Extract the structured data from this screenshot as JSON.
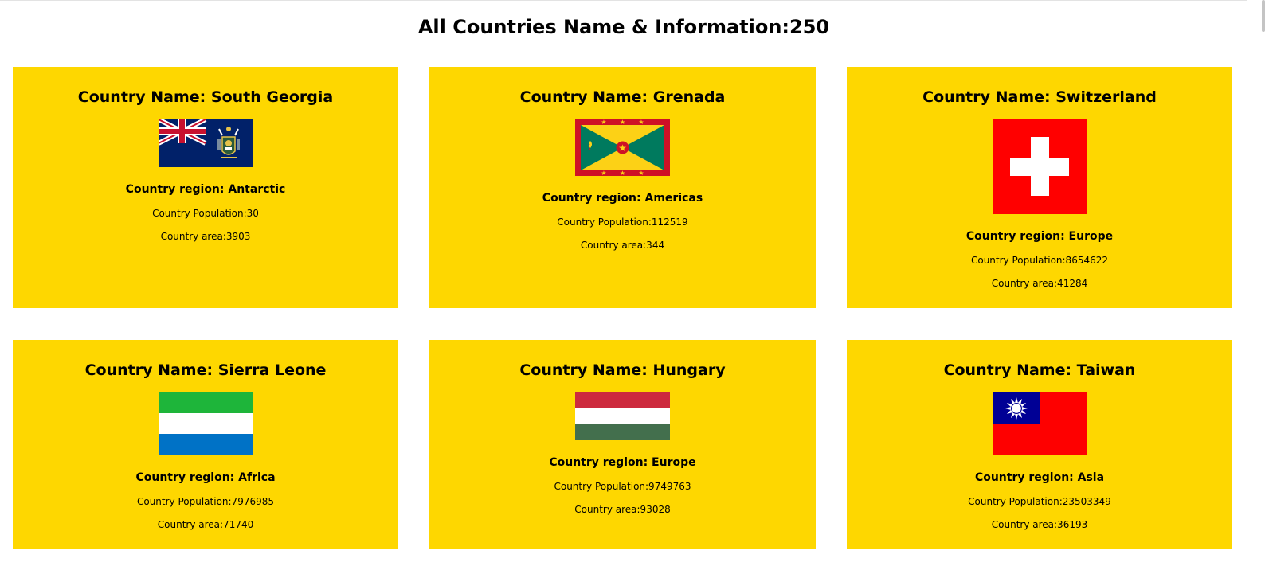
{
  "page": {
    "title": "All Countries Name & Information:250"
  },
  "labels": {
    "name_prefix": "Country Name: ",
    "region_prefix": "Country region: ",
    "population_prefix": "Country Population:",
    "area_prefix": "Country area:"
  },
  "colors": {
    "card_background": "#fed700"
  },
  "countries": [
    {
      "name": "Country Name: South Georgia",
      "flag_icon": "south-georgia-flag-icon",
      "region": "Country region: Antarctic",
      "population": "Country Population:30",
      "area": "Country area:3903"
    },
    {
      "name": "Country Name: Grenada",
      "flag_icon": "grenada-flag-icon",
      "region": "Country region: Americas",
      "population": "Country Population:112519",
      "area": "Country area:344"
    },
    {
      "name": "Country Name: Switzerland",
      "flag_icon": "switzerland-flag-icon",
      "region": "Country region: Europe",
      "population": "Country Population:8654622",
      "area": "Country area:41284"
    },
    {
      "name": "Country Name: Sierra Leone",
      "flag_icon": "sierra-leone-flag-icon",
      "region": "Country region: Africa",
      "population": "Country Population:7976985",
      "area": "Country area:71740"
    },
    {
      "name": "Country Name: Hungary",
      "flag_icon": "hungary-flag-icon",
      "region": "Country region: Europe",
      "population": "Country Population:9749763",
      "area": "Country area:93028"
    },
    {
      "name": "Country Name: Taiwan",
      "flag_icon": "taiwan-flag-icon",
      "region": "Country region: Asia",
      "population": "Country Population:23503349",
      "area": "Country area:36193"
    }
  ]
}
